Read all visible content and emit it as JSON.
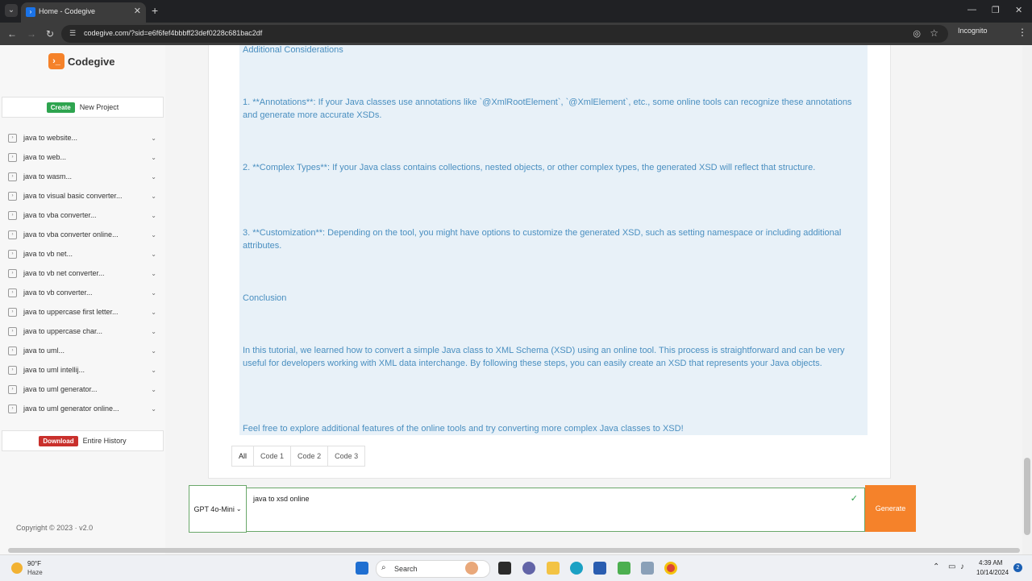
{
  "browser": {
    "tab_title": "Home - Codegive",
    "url": "codegive.com/?sid=e6f6fef4bbbff23def0228c681bac2df",
    "incognito_label": "Incognito"
  },
  "sidebar": {
    "brand": "Codegive",
    "create_badge": "Create",
    "create_label": "New Project",
    "history": [
      {
        "label": "java to website..."
      },
      {
        "label": "java to web..."
      },
      {
        "label": "java to wasm..."
      },
      {
        "label": "java to visual basic converter..."
      },
      {
        "label": "java to vba converter..."
      },
      {
        "label": "java to vba converter online..."
      },
      {
        "label": "java to vb net..."
      },
      {
        "label": "java to vb net converter..."
      },
      {
        "label": "java to vb converter..."
      },
      {
        "label": "java to uppercase first letter..."
      },
      {
        "label": "java to uppercase char..."
      },
      {
        "label": "java to uml..."
      },
      {
        "label": "java to uml intellij..."
      },
      {
        "label": "java to uml generator..."
      },
      {
        "label": "java to uml generator online..."
      }
    ],
    "download_badge": "Download",
    "download_label": "Entire History",
    "copyright": "Copyright © 2023  ·  v2.0"
  },
  "response": {
    "heading1": "Additional Considerations",
    "p1": "1. **Annotations**: If your Java classes use annotations like `@XmlRootElement`, `@XmlElement`, etc., some online tools can recognize these annotations and generate more accurate XSDs.",
    "p2": "2. **Complex Types**: If your Java class contains collections, nested objects, or other complex types, the generated XSD will reflect that structure.",
    "p3": "3. **Customization**: Depending on the tool, you might have options to customize the generated XSD, such as setting namespace or including additional attributes.",
    "heading2": "Conclusion",
    "p4": "In this tutorial, we learned how to convert a simple Java class to XML Schema (XSD) using an online tool. This process is straightforward and can be very useful for developers working with XML data interchange. By following these steps, you can easily create an XSD that represents your Java objects.",
    "p5": "Feel free to explore additional features of the online tools and try converting more complex Java classes to XSD!"
  },
  "code_tabs": [
    "All",
    "Code 1",
    "Code 2",
    "Code 3"
  ],
  "input": {
    "model": "GPT 4o-Mini",
    "prompt": "java to xsd online",
    "generate_label": "Generate"
  },
  "taskbar": {
    "temp": "90°F",
    "condition": "Haze",
    "search_label": "Search",
    "time": "4:39 AM",
    "date": "10/14/2024",
    "notifications": "2"
  }
}
